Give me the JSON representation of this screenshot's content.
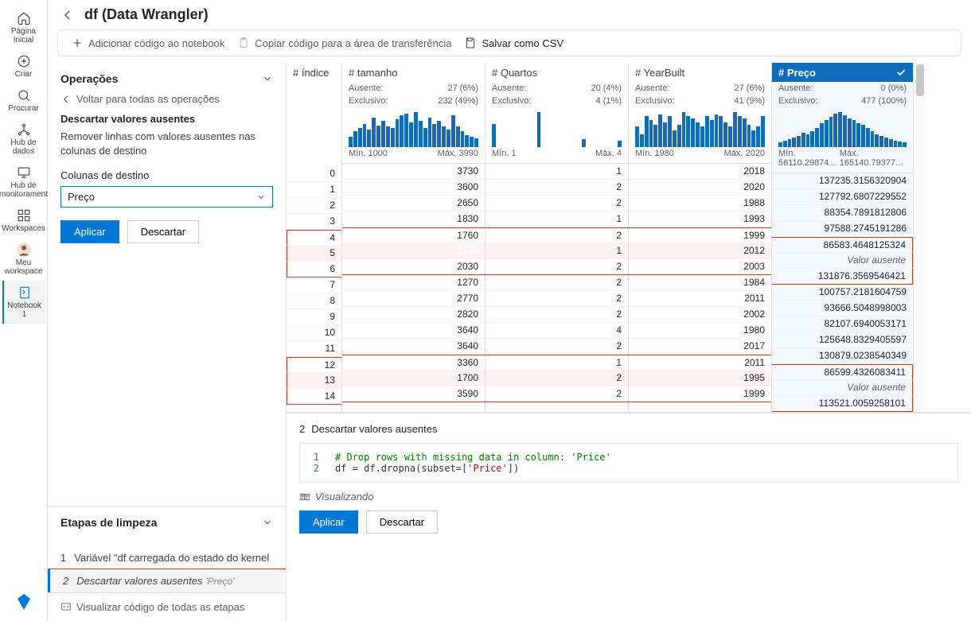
{
  "nav": {
    "home": "Página Inicial",
    "create": "Criar",
    "browse": "Procurar",
    "data_hub": "Hub\nde dados",
    "monitor_hub": "Hub de\nmonitorament",
    "workspaces": "Workspaces",
    "my_ws": "Meu\nworkspace",
    "notebook": "Notebook 1"
  },
  "header": {
    "title": "df (Data Wrangler)"
  },
  "toolbar": {
    "add_code": "Adicionar código ao notebook",
    "copy": "Copiar código para a área de transferência",
    "save_csv": "Salvar como CSV"
  },
  "ops": {
    "section_title": "Operações",
    "back": "Voltar para todas as operações",
    "op_title": "Descartar valores ausentes",
    "op_desc": "Remover linhas com valores ausentes nas colunas de destino",
    "target_label": "Colunas de destino",
    "target_value": "Preço",
    "apply": "Aplicar",
    "discard": "Descartar"
  },
  "steps": {
    "title": "Etapas de limpeza",
    "s1_num": "1",
    "s1_label": "Variável \"df carregada do estado do kernel",
    "s2_num": "2",
    "s2_label": "Descartar valores ausentes",
    "s2_sub": "'Preço'",
    "footer": "Visualizar código de todas as etapas"
  },
  "columns": {
    "idx": "# índice",
    "tamanho": "# tamanho",
    "quartos": "# Quartos",
    "year": "# YearBuilt",
    "preco": "# Preço",
    "ausente": "Ausente:",
    "exclusivo": "Exclusivo:",
    "tam_miss": "27 (6%)",
    "tam_unq": "232 (49%)",
    "tam_min": "Mín. 1000",
    "tam_max": "Máx. 3990",
    "q_miss": "20 (4%)",
    "q_unq": "4 (1%)",
    "q_min": "Mín. 1",
    "q_max": "Máx. 4",
    "y_miss": "27 (6%)",
    "y_unq": "41 (9%)",
    "y_min": "Mín. 1980",
    "y_max": "Máx. 2020",
    "p_miss": "0 (0%)",
    "p_unq": "477 (100%)",
    "p_min": "Mín. 56110.29874...",
    "p_max": "Máx. 165140.79377..."
  },
  "rows": [
    {
      "idx": "0",
      "tam": "3730",
      "q": "1",
      "y": "2018",
      "p": "137235.3156320904"
    },
    {
      "idx": "1",
      "tam": "3600",
      "q": "2",
      "y": "2020",
      "p": "127792.6807229552"
    },
    {
      "idx": "2",
      "tam": "2650",
      "q": "2",
      "y": "1988",
      "p": "88354.7891812806"
    },
    {
      "idx": "3",
      "tam": "1830",
      "q": "1",
      "y": "1993",
      "p": "97588.2745191286"
    },
    {
      "idx": "4",
      "tam": "1760",
      "q": "2",
      "y": "1999",
      "p": "86583.4648125324",
      "boxtop": true
    },
    {
      "idx": "5",
      "tam": "2730",
      "q": "1",
      "y": "2012",
      "p": "Valor ausente",
      "miss": true,
      "sel": true
    },
    {
      "idx": "6",
      "tam": "2030",
      "q": "2",
      "y": "2003",
      "p": "131876.3569546421",
      "boxbot": true
    },
    {
      "idx": "7",
      "tam": "1270",
      "q": "2",
      "y": "1984",
      "p": "100757.2181604759"
    },
    {
      "idx": "8",
      "tam": "2770",
      "q": "2",
      "y": "2011",
      "p": "93666.5048998003"
    },
    {
      "idx": "9",
      "tam": "2820",
      "q": "2",
      "y": "2002",
      "p": "82107.6940053171"
    },
    {
      "idx": "10",
      "tam": "3640",
      "q": "4",
      "y": "1980",
      "p": "125648.8329405597"
    },
    {
      "idx": "11",
      "tam": "3640",
      "q": "2",
      "y": "2017",
      "p": "130879.0238540349"
    },
    {
      "idx": "12",
      "tam": "3360",
      "q": "1",
      "y": "2011",
      "p": "86599.4326083411",
      "boxtop": true
    },
    {
      "idx": "13",
      "tam": "1700",
      "q": "2",
      "y": "1995",
      "p": "Valor ausente",
      "miss": true
    },
    {
      "idx": "14",
      "tam": "3590",
      "q": "2",
      "y": "1999",
      "p": "113521.0059258101",
      "boxbot": true
    }
  ],
  "code": {
    "step_num": "2",
    "step_label": "Descartar valores ausentes",
    "l1_num": "1",
    "l1": "# Drop rows with missing data in column: 'Price'",
    "l2_num": "2",
    "l2_a": "df = df.dropna(subset=[",
    "l2_b": "'Price'",
    "l2_c": "])",
    "status": "Visualizando",
    "apply": "Aplicar",
    "discard": "Descartar"
  }
}
